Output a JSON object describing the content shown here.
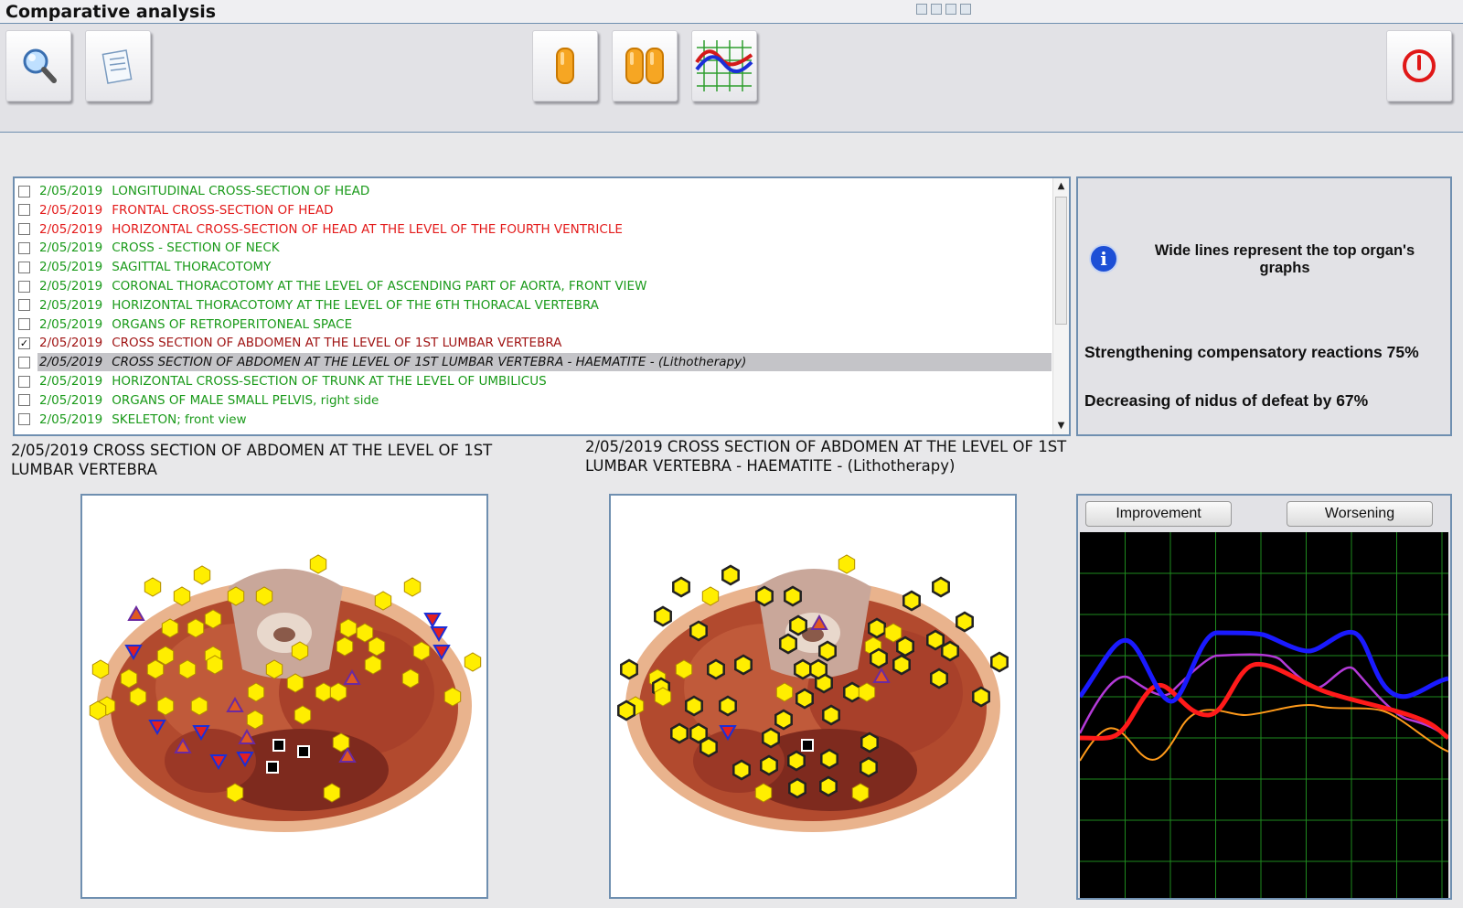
{
  "window": {
    "title": "Comparative analysis"
  },
  "toolbar": {
    "buttons": [
      {
        "name": "search-button",
        "icon": "magnifier-icon"
      },
      {
        "name": "report-button",
        "icon": "document-icon"
      },
      {
        "name": "single-view-button",
        "icon": "single-capsule-icon"
      },
      {
        "name": "compare-view-button",
        "icon": "double-capsule-icon"
      },
      {
        "name": "graph-view-button",
        "icon": "graph-icon"
      },
      {
        "name": "exit-button",
        "icon": "power-icon"
      }
    ]
  },
  "list": {
    "rows": [
      {
        "checked": false,
        "date": "2/05/2019",
        "text": "LONGITUDINAL CROSS-SECTION OF HEAD",
        "color": "green"
      },
      {
        "checked": false,
        "date": "2/05/2019",
        "text": "FRONTAL CROSS-SECTION OF HEAD",
        "color": "red"
      },
      {
        "checked": false,
        "date": "2/05/2019",
        "text": "HORIZONTAL CROSS-SECTION OF HEAD AT THE LEVEL OF THE FOURTH VENTRICLE",
        "color": "red"
      },
      {
        "checked": false,
        "date": "2/05/2019",
        "text": "CROSS - SECTION OF NECK",
        "color": "green"
      },
      {
        "checked": false,
        "date": "2/05/2019",
        "text": "SAGITTAL THORACOTOMY",
        "color": "green"
      },
      {
        "checked": false,
        "date": "2/05/2019",
        "text": "CORONAL THORACOTOMY AT THE LEVEL OF ASCENDING PART OF AORTA, FRONT VIEW",
        "color": "green"
      },
      {
        "checked": false,
        "date": "2/05/2019",
        "text": "HORIZONTAL THORACOTOMY AT THE LEVEL OF THE 6TH THORACAL VERTEBRA",
        "color": "green"
      },
      {
        "checked": false,
        "date": "2/05/2019",
        "text": "ORGANS OF RETROPERITONEAL SPACE",
        "color": "green"
      },
      {
        "checked": true,
        "date": "2/05/2019",
        "text": "CROSS SECTION OF ABDOMEN AT THE LEVEL OF 1ST LUMBAR VERTEBRA",
        "color": "darkred"
      },
      {
        "checked": false,
        "date": "2/05/2019",
        "text": "CROSS SECTION OF ABDOMEN AT THE LEVEL OF 1ST LUMBAR VERTEBRA - HAEMATITE - (Lithotherapy)",
        "color": "selected"
      },
      {
        "checked": false,
        "date": "2/05/2019",
        "text": "HORIZONTAL CROSS-SECTION OF TRUNK AT THE LEVEL OF UMBILICUS",
        "color": "green"
      },
      {
        "checked": false,
        "date": "2/05/2019",
        "text": "ORGANS OF MALE SMALL PELVIS, right side",
        "color": "green"
      },
      {
        "checked": false,
        "date": "2/05/2019",
        "text": "SKELETON; front view",
        "color": "green"
      }
    ]
  },
  "info": {
    "note": "Wide lines represent the top organ's graphs",
    "stat1": "Strengthening compensatory reactions 75%",
    "stat2": "Decreasing of nidus of defeat by 67%"
  },
  "captions": {
    "left": "2/05/2019  CROSS SECTION OF ABDOMEN AT THE LEVEL OF 1ST LUMBAR VERTEBRA",
    "right": "2/05/2019  CROSS SECTION OF ABDOMEN AT THE LEVEL OF 1ST LUMBAR VERTEBRA - HAEMATITE - (Lithotherapy)"
  },
  "graph": {
    "improvement_label": "Improvement",
    "worsening_label": "Worsening"
  },
  "colors": {
    "green_text": "#1a9a1a",
    "red_text": "#e31b1b",
    "frame_border": "#6f8fb0",
    "marker_fill": "#ffee00"
  }
}
